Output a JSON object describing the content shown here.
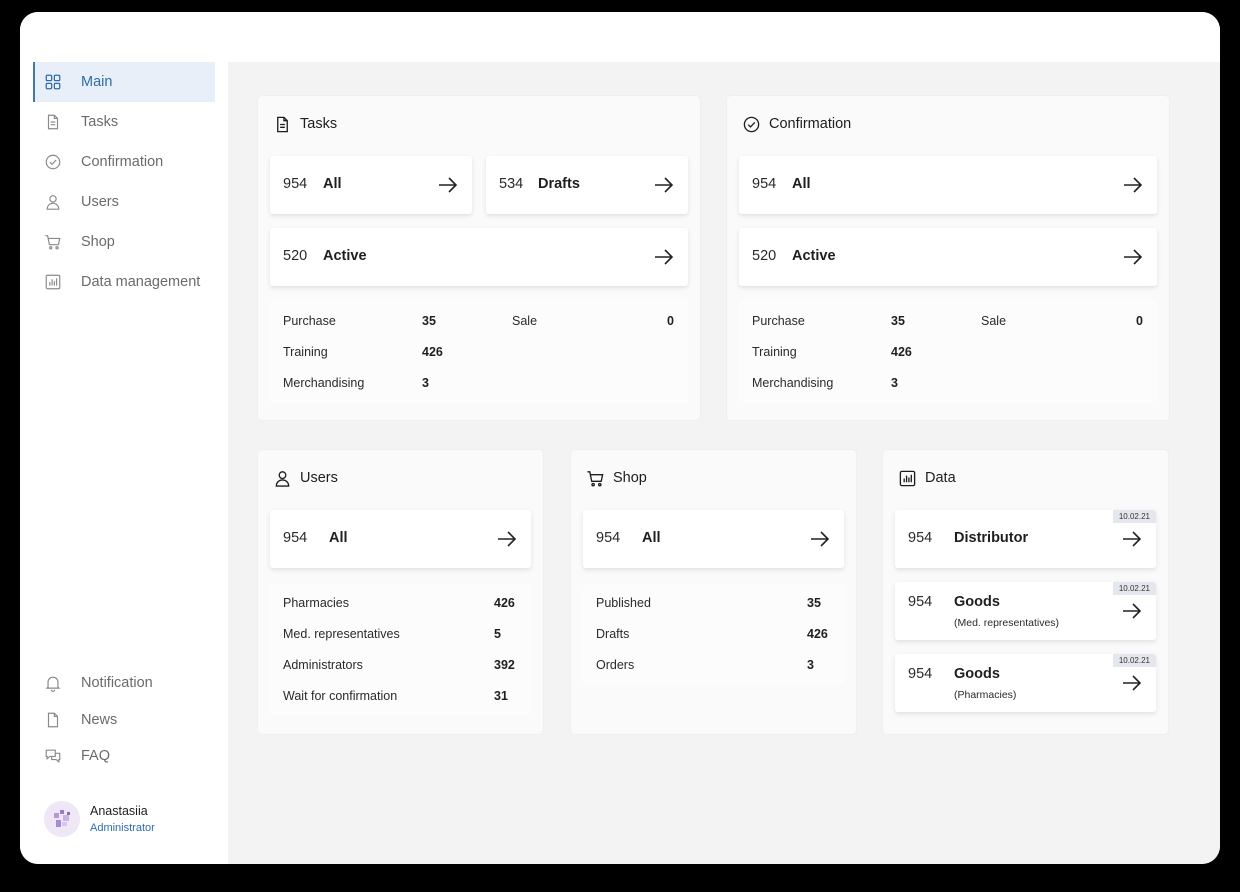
{
  "sidebar": {
    "main_nav": [
      {
        "label": "Main",
        "icon": "grid-icon",
        "active": true
      },
      {
        "label": "Tasks",
        "icon": "document-icon"
      },
      {
        "label": "Confirmation",
        "icon": "check-circle-icon"
      },
      {
        "label": "Users",
        "icon": "user-icon"
      },
      {
        "label": "Shop",
        "icon": "cart-icon"
      },
      {
        "label": "Data management",
        "icon": "bar-chart-icon"
      }
    ],
    "bottom_nav": [
      {
        "label": "Notification",
        "icon": "bell-icon"
      },
      {
        "label": "News",
        "icon": "document-icon"
      },
      {
        "label": "FAQ",
        "icon": "chat-icon"
      }
    ],
    "profile": {
      "name": "Anastasiia",
      "role": "Administrator"
    }
  },
  "colors": {
    "accent": "#2f6cab",
    "active_bg": "#e9eff8",
    "content_bg": "#f3f3f3"
  },
  "tasks": {
    "title": "Tasks",
    "tiles": [
      {
        "num": "954",
        "label": "All"
      },
      {
        "num": "534",
        "label": "Drafts"
      },
      {
        "num": "520",
        "label": "Active"
      }
    ],
    "stats": [
      {
        "label": "Purchase",
        "value": "35"
      },
      {
        "label": "Sale",
        "value": "0"
      },
      {
        "label": "Training",
        "value": "426"
      },
      {
        "label": "Merchandising",
        "value": "3"
      }
    ]
  },
  "confirmation": {
    "title": "Confirmation",
    "tiles": [
      {
        "num": "954",
        "label": "All"
      },
      {
        "num": "520",
        "label": "Active"
      }
    ],
    "stats": [
      {
        "label": "Purchase",
        "value": "35"
      },
      {
        "label": "Sale",
        "value": "0"
      },
      {
        "label": "Training",
        "value": "426"
      },
      {
        "label": "Merchandising",
        "value": "3"
      }
    ]
  },
  "users": {
    "title": "Users",
    "tile": {
      "num": "954",
      "label": "All"
    },
    "stats": [
      {
        "label": "Pharmacies",
        "value": "426"
      },
      {
        "label": "Med. representatives",
        "value": "5"
      },
      {
        "label": "Administrators",
        "value": "392"
      },
      {
        "label": "Wait for confirmation",
        "value": "31"
      }
    ]
  },
  "shop": {
    "title": "Shop",
    "tile": {
      "num": "954",
      "label": "All"
    },
    "stats": [
      {
        "label": "Published",
        "value": "35"
      },
      {
        "label": "Drafts",
        "value": "426"
      },
      {
        "label": "Orders",
        "value": "3"
      }
    ]
  },
  "data": {
    "title": "Data",
    "tiles": [
      {
        "num": "954",
        "label": "Distributor",
        "sub": "",
        "date": "10.02.21"
      },
      {
        "num": "954",
        "label": "Goods",
        "sub": "(Med. representatives)",
        "date": "10.02.21"
      },
      {
        "num": "954",
        "label": "Goods",
        "sub": "(Pharmacies)",
        "date": "10.02.21"
      }
    ]
  }
}
